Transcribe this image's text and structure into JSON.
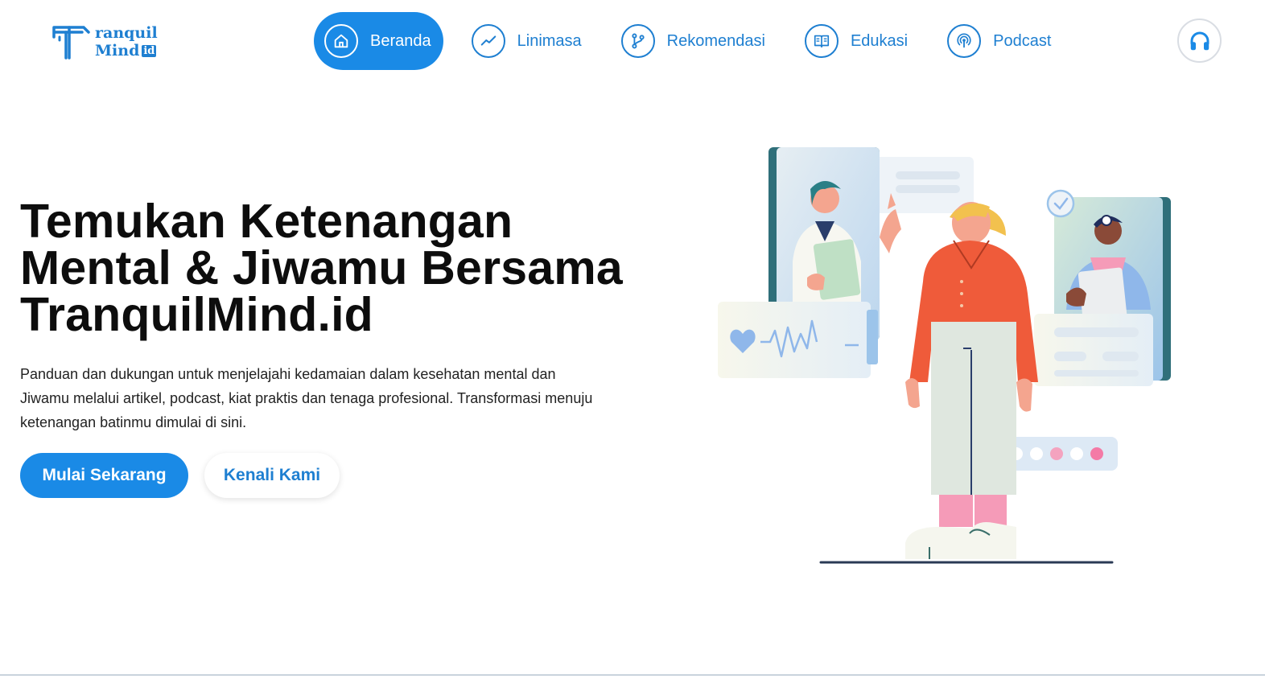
{
  "logo": {
    "line1": "ranquil",
    "line2": "Mind",
    "badge": "id"
  },
  "nav": {
    "items": [
      {
        "label": "Beranda",
        "icon": "home-icon",
        "active": true
      },
      {
        "label": "Linimasa",
        "icon": "trend-icon",
        "active": false
      },
      {
        "label": "Rekomendasi",
        "icon": "branch-icon",
        "active": false
      },
      {
        "label": "Edukasi",
        "icon": "book-icon",
        "active": false
      },
      {
        "label": "Podcast",
        "icon": "podcast-icon",
        "active": false
      }
    ]
  },
  "audio_button": {
    "icon": "headphones-icon"
  },
  "hero": {
    "title_line1": "Temukan Ketenangan",
    "title_line2": "Mental & Jiwamu Bersama",
    "title_line3": "TranquilMind.id",
    "desc_line1": "Panduan dan dukungan untuk menjelajahi kedamaian dalam kesehatan mental dan",
    "desc_line2": "Jiwamu melalui artikel, podcast, kiat praktis dan tenaga profesional. Transformasi menuju",
    "desc_line3": "ketenangan batinmu dimulai di sini.",
    "primary_button": "Mulai Sekarang",
    "secondary_button": "Kenali Kami"
  },
  "colors": {
    "accent": "#1a8ae6",
    "brand": "#1e7fd1",
    "text": "#0d0d0d",
    "figure_shirt": "#ef5b3a",
    "figure_pants": "#dfe7df",
    "socks": "#f59bb8"
  }
}
